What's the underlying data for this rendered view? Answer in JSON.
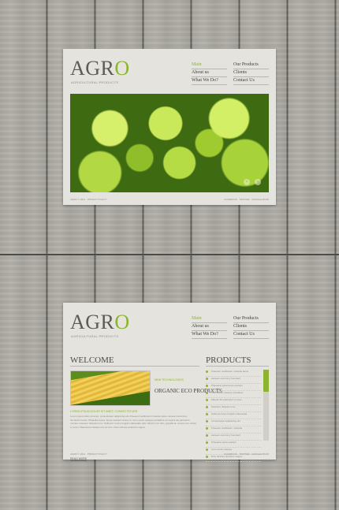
{
  "brand": {
    "logo_prefix": "AGR",
    "logo_accent": "O",
    "tagline": "AGRICULTURAL PRODUCTS",
    "accent_color": "#8cb42f"
  },
  "nav": {
    "main": "Main",
    "about": "About us",
    "what": "What We Do?",
    "products": "Our Products",
    "clients": "Clients",
    "contacts": "Contact Us"
  },
  "slider": {
    "prev_icon": "‹",
    "next_icon": "›"
  },
  "footer": {
    "left": "AGRO © 2011 · PRIVACY POLICY",
    "right": "FACEBOOK · TWITTER · GOOGLE BUZZ"
  },
  "welcome": {
    "title": "WELCOME",
    "new_tech": "NEW TECHNOLOGIES",
    "organic_title": "ORGANIC ECO PRODUCTS",
    "sub": "LOREM IPSUM DOLOR SIT AMET, CONSECTETUER",
    "body": "Lorem ipsum dolor sit amet, consectetuer adipiscing elit. Praesent vestibulum molestie lacus. Aenean nonummy hendrerit mauris. Phasellus porta. Fusce suscipit varius mi. Cum sociis natoque penatibus et magnis dis parturient montes, nascetur ridiculus mus. Nulla dui. Fusce feugiat malesuada odio. Morbi nunc odio, gravida at, cursus nec, luctus a, lorem. Maecenas tristique orci ac sem. Duis ultricies pharetra magna.",
    "read_more": "READ MORE"
  },
  "products": {
    "title": "PRODUCTS",
    "items": [
      "Praesent vestibulum molestie lacus",
      "Aenean nonummy hendrerit",
      "Phasellus porta fusce suscipit",
      "Cum sociis natoque penatibus",
      "Magnis dis parturient montes",
      "Nascetur ridiculus mus",
      "Nulla dui fusce feugiat malesuada",
      "Consectetuer adipiscing elit",
      "Praesent vestibulum molestie",
      "Aenean nonummy hendrerit",
      "Phasellus porta suscipit",
      "Cum sociis natoque",
      "Duis ultricies pharetra magna"
    ]
  }
}
